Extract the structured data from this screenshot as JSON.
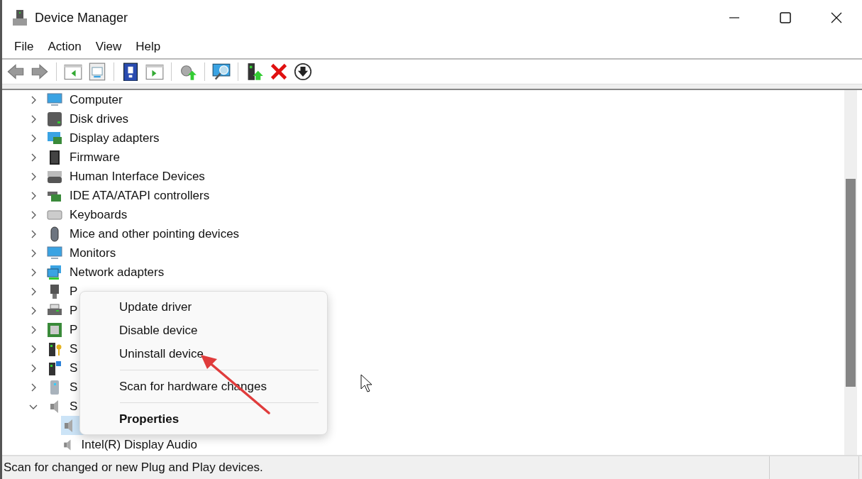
{
  "window": {
    "title": "Device Manager"
  },
  "menu": [
    "File",
    "Action",
    "View",
    "Help"
  ],
  "toolbar": [
    {
      "kind": "back"
    },
    {
      "kind": "forward"
    },
    {
      "kind": "sep"
    },
    {
      "kind": "tree-pane"
    },
    {
      "kind": "properties"
    },
    {
      "kind": "sep"
    },
    {
      "kind": "help"
    },
    {
      "kind": "action-pane"
    },
    {
      "kind": "sep"
    },
    {
      "kind": "update-driver"
    },
    {
      "kind": "sep"
    },
    {
      "kind": "scan"
    },
    {
      "kind": "sep"
    },
    {
      "kind": "enable"
    },
    {
      "kind": "uninstall"
    },
    {
      "kind": "download"
    }
  ],
  "tree": [
    {
      "label": "Computer",
      "kind": "monitor",
      "expanded": false
    },
    {
      "label": "Disk drives",
      "kind": "disk",
      "expanded": false
    },
    {
      "label": "Display adapters",
      "kind": "display",
      "expanded": false
    },
    {
      "label": "Firmware",
      "kind": "chip",
      "expanded": false
    },
    {
      "label": "Human Interface Devices",
      "kind": "hid",
      "expanded": false
    },
    {
      "label": "IDE ATA/ATAPI controllers",
      "kind": "ide",
      "expanded": false
    },
    {
      "label": "Keyboards",
      "kind": "keyboard",
      "expanded": false
    },
    {
      "label": "Mice and other pointing devices",
      "kind": "mouse",
      "expanded": false
    },
    {
      "label": "Monitors",
      "kind": "monitor",
      "expanded": false
    },
    {
      "label": "Network adapters",
      "kind": "network",
      "expanded": false
    },
    {
      "label": "P",
      "kind": "port",
      "expanded": false
    },
    {
      "label": "P",
      "kind": "printer",
      "expanded": false
    },
    {
      "label": "P",
      "kind": "processor",
      "expanded": false
    },
    {
      "label": "S",
      "kind": "security",
      "expanded": false
    },
    {
      "label": "S",
      "kind": "software",
      "expanded": false
    },
    {
      "label": "S",
      "kind": "storage",
      "expanded": false
    },
    {
      "label": "S",
      "kind": "speaker",
      "expanded": true,
      "children": [
        {
          "kind": "speaker",
          "selected": true
        },
        {
          "label": "Intel(R) Display Audio",
          "kind": "speaker",
          "selected": false
        }
      ]
    }
  ],
  "context_menu": [
    {
      "label": "Update driver",
      "kind": "item"
    },
    {
      "label": "Disable device",
      "kind": "item"
    },
    {
      "label": "Uninstall device",
      "kind": "item"
    },
    {
      "kind": "separator"
    },
    {
      "label": "Scan for hardware changes",
      "kind": "item"
    },
    {
      "kind": "separator"
    },
    {
      "label": "Properties",
      "kind": "default"
    }
  ],
  "status_bar": "Scan for changed or new Plug and Play devices."
}
